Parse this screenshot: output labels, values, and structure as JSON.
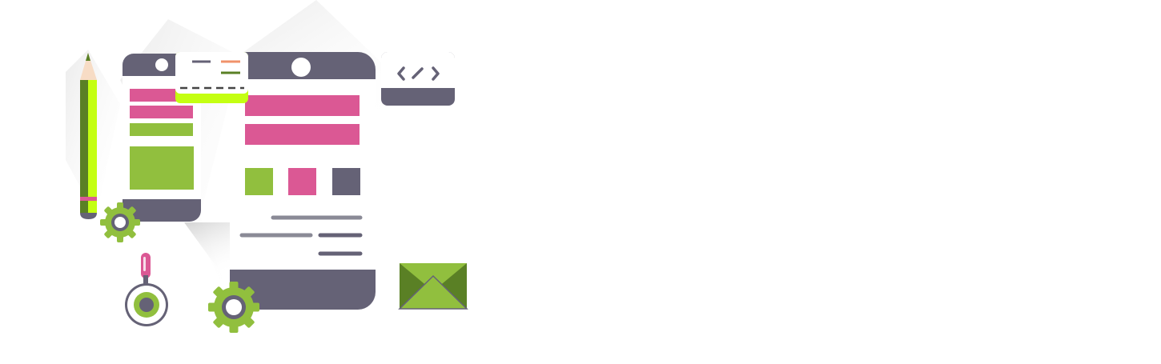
{
  "illustration": {
    "subject": "mobile-app-development",
    "icons": [
      "pencil-icon",
      "small-phone-icon",
      "large-phone-icon",
      "code-card-icon",
      "settings-card-icon",
      "gear-icon",
      "magnifier-icon",
      "envelope-icon"
    ],
    "code_glyph": "</>"
  },
  "colors": {
    "slate": "#656276",
    "magenta": "#db5894",
    "green": "#91bf3e",
    "dark_green": "#5a8025",
    "lime": "#c4ff12",
    "gray_line": "#8a8a96",
    "orange": "#f0926a",
    "white": "#ffffff",
    "shadow": "#e6e6e6"
  }
}
